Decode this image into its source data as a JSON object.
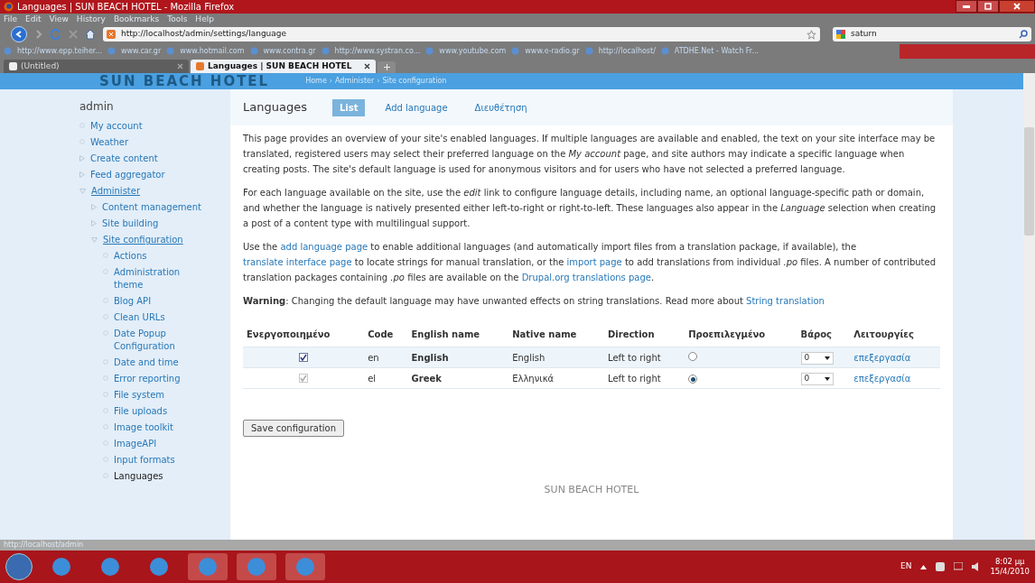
{
  "window": {
    "title": "Languages | SUN BEACH HOTEL - Mozilla Firefox"
  },
  "menu": [
    "File",
    "Edit",
    "View",
    "History",
    "Bookmarks",
    "Tools",
    "Help"
  ],
  "address": {
    "value": "http://localhost/admin/settings/language"
  },
  "search": {
    "value": "saturn"
  },
  "bookmarks": [
    {
      "label": "http://www.epp.teiher..."
    },
    {
      "label": "www.car.gr"
    },
    {
      "label": "www.hotmail.com"
    },
    {
      "label": "www.contra.gr"
    },
    {
      "label": "http://www.systran.co..."
    },
    {
      "label": "www.youtube.com"
    },
    {
      "label": "www.e-radio.gr"
    },
    {
      "label": "http://localhost/"
    },
    {
      "label": "ATDHE.Net - Watch Fr..."
    }
  ],
  "browser_tabs": [
    {
      "label": "(Untitled)",
      "selected": false
    },
    {
      "label": "Languages | SUN BEACH HOTEL",
      "selected": true
    }
  ],
  "site": {
    "logo": "SUN BEACH HOTEL",
    "breadcrumb": [
      "Home",
      "Administer",
      "Site configuration"
    ],
    "breadcrumb_separator": "›"
  },
  "sidebar": {
    "title": "admin",
    "items": [
      {
        "label": "My account",
        "selected": false
      },
      {
        "label": "Weather",
        "selected": false
      },
      {
        "label": "Create content",
        "expanded": false,
        "selected": false
      },
      {
        "label": "Feed aggregator",
        "expanded": false,
        "selected": false
      },
      {
        "label": "Administer",
        "expanded": true,
        "selected": false,
        "children": [
          {
            "label": "Content management",
            "expanded": false,
            "selected": false
          },
          {
            "label": "Site building",
            "expanded": false,
            "selected": false
          },
          {
            "label": "Site configuration",
            "expanded": true,
            "selected": false,
            "children": [
              {
                "label": "Actions",
                "selected": false
              },
              {
                "label": "Administration theme",
                "selected": false
              },
              {
                "label": "Blog API",
                "selected": false
              },
              {
                "label": "Clean URLs",
                "selected": false
              },
              {
                "label": "Date Popup Configuration",
                "selected": false
              },
              {
                "label": "Date and time",
                "selected": false
              },
              {
                "label": "Error reporting",
                "selected": false
              },
              {
                "label": "File system",
                "selected": false
              },
              {
                "label": "File uploads",
                "selected": false
              },
              {
                "label": "Image toolkit",
                "selected": false
              },
              {
                "label": "ImageAPI",
                "selected": false
              },
              {
                "label": "Input formats",
                "selected": false
              },
              {
                "label": "Languages",
                "selected": true
              }
            ]
          }
        ]
      }
    ]
  },
  "page": {
    "title": "Languages",
    "tabs": [
      {
        "label": "List",
        "selected": true
      },
      {
        "label": "Add language",
        "selected": false
      },
      {
        "label": "Διευθέτηση",
        "selected": false
      }
    ],
    "paragraphs": [
      [
        {
          "kind": "text",
          "text": "This page provides an overview of your site's enabled languages. If multiple languages are available and enabled, the text on your site interface may be translated, registered users may select their preferred language on the "
        },
        {
          "kind": "italic",
          "text": "My account"
        },
        {
          "kind": "text",
          "text": " page, and site authors may indicate a specific language when creating posts. The site's default language is used for anonymous visitors and for users who have not selected a preferred language."
        }
      ],
      [
        {
          "kind": "text",
          "text": "For each language available on the site, use the "
        },
        {
          "kind": "italic",
          "text": "edit"
        },
        {
          "kind": "text",
          "text": " link to configure language details, including name, an optional language-specific path or domain, and whether the language is natively presented either left-to-right or right-to-left. These languages also appear in the "
        },
        {
          "kind": "italic",
          "text": "Language"
        },
        {
          "kind": "text",
          "text": " selection when creating a post of a content type with multilingual support."
        }
      ],
      [
        {
          "kind": "text",
          "text": "Use the "
        },
        {
          "kind": "link",
          "text": "add language page"
        },
        {
          "kind": "text",
          "text": " to enable additional languages (and automatically import files from a translation package, if available), the "
        },
        {
          "kind": "link",
          "text": "translate interface page"
        },
        {
          "kind": "text",
          "text": " to locate strings for manual translation, or the "
        },
        {
          "kind": "link",
          "text": "import page"
        },
        {
          "kind": "text",
          "text": " to add translations from individual "
        },
        {
          "kind": "italic",
          "text": ".po"
        },
        {
          "kind": "text",
          "text": " files. A number of contributed translation packages containing "
        },
        {
          "kind": "italic",
          "text": ".po"
        },
        {
          "kind": "text",
          "text": " files are available on the "
        },
        {
          "kind": "link",
          "text": "Drupal.org translations page"
        },
        {
          "kind": "text",
          "text": "."
        }
      ],
      [
        {
          "kind": "bold",
          "text": "Warning"
        },
        {
          "kind": "text",
          "text": ": Changing the default language may have unwanted effects on string translations. Read more about "
        },
        {
          "kind": "link",
          "text": "String translation"
        }
      ]
    ],
    "table": {
      "columns": [
        "Ενεργοποιημένο",
        "Code",
        "English name",
        "Native name",
        "Direction",
        "Προεπιλεγμένο",
        "Βάρος",
        "Λειτουργίες"
      ],
      "rows": [
        {
          "enabled": true,
          "disabled": false,
          "code": "en",
          "english_name": "English",
          "native_name": "English",
          "direction": "Left to right",
          "default": false,
          "weight": "0",
          "operation": "επεξεργασία"
        },
        {
          "enabled": true,
          "disabled": true,
          "code": "el",
          "english_name": "Greek",
          "native_name": "Ελληνικά",
          "direction": "Left to right",
          "default": true,
          "weight": "0",
          "operation": "επεξεργασία"
        }
      ]
    },
    "save_button": "Save configuration",
    "footer": "SUN BEACH HOTEL"
  },
  "status_bar": "http://localhost/admin",
  "taskbar": {
    "language": "EN",
    "time": "8:02 μμ",
    "date": "15/4/2010"
  }
}
